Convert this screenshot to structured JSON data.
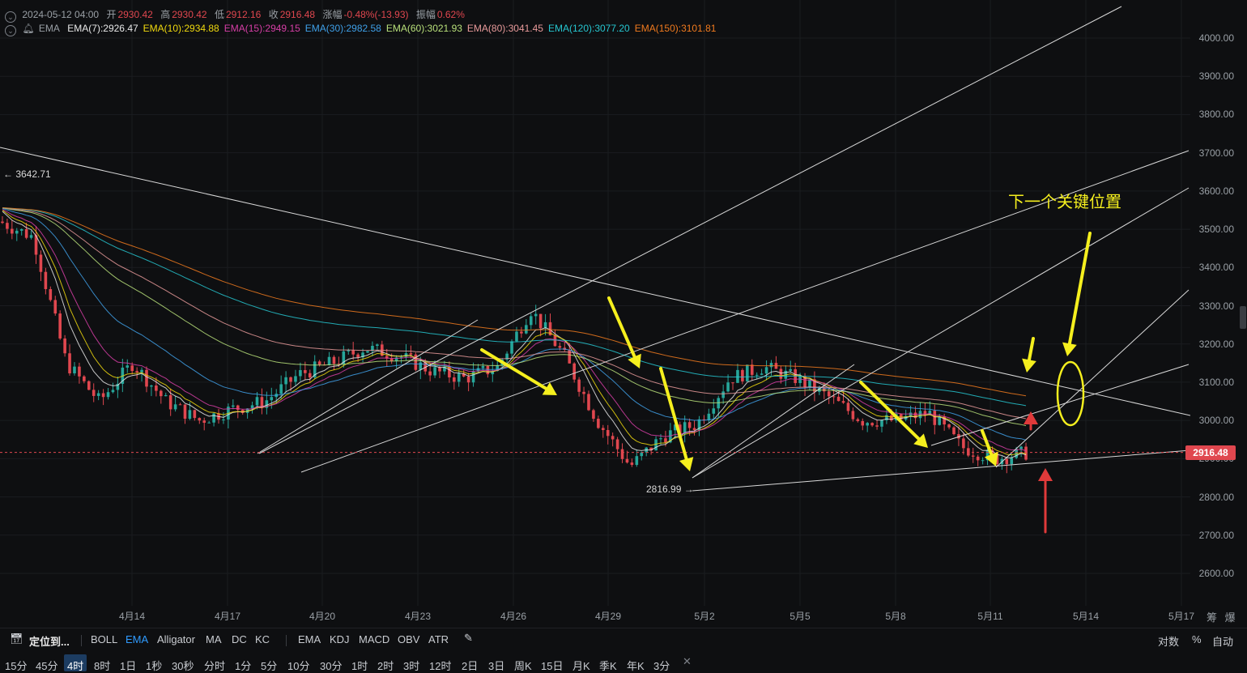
{
  "info": {
    "date": "2024-05-12 04:00",
    "open_label": "开",
    "open": "2930.42",
    "high_label": "高",
    "high": "2930.42",
    "low_label": "低",
    "low": "2912.16",
    "close_label": "收",
    "close": "2916.48",
    "change_label": "涨幅",
    "change": "-0.48%(-13.93)",
    "amp_label": "振幅",
    "amp": "0.62%",
    "ema_label": "EMA"
  },
  "emas": [
    {
      "text": "EMA(7):2926.47",
      "color": "#e8e8e8"
    },
    {
      "text": "EMA(10):2934.88",
      "color": "#f0d90e"
    },
    {
      "text": "EMA(15):2949.15",
      "color": "#d63ea6"
    },
    {
      "text": "EMA(30):2982.58",
      "color": "#3fa0e8"
    },
    {
      "text": "EMA(60):3021.93",
      "color": "#b8e07a"
    },
    {
      "text": "EMA(80):3041.45",
      "color": "#e89a9a"
    },
    {
      "text": "EMA(120):3077.20",
      "color": "#26c6d0"
    },
    {
      "text": "EMA(150):3101.81",
      "color": "#f07a1e"
    }
  ],
  "chart_data": {
    "type": "candlestick",
    "price_ticks": [
      "4000.00",
      "3900.00",
      "3800.00",
      "3700.00",
      "3600.00",
      "3500.00",
      "3400.00",
      "3300.00",
      "3200.00",
      "3100.00",
      "3000.00",
      "2900.00",
      "2800.00",
      "2700.00",
      "2600.00"
    ],
    "date_ticks": [
      "4月14",
      "4月17",
      "4月20",
      "4月23",
      "4月26",
      "4月29",
      "5月2",
      "5月5",
      "5月8",
      "5月11",
      "5月14",
      "5月17"
    ],
    "current_price": "2916.48",
    "high_marker": "3642.71",
    "low_marker": "2816.99",
    "annotation": "下一个关键位置",
    "close_path": [
      [
        "4月13",
        3520
      ],
      [
        "4月14",
        3480
      ],
      [
        "4月14",
        3150
      ],
      [
        "4月15",
        3050
      ],
      [
        "4月16",
        3150
      ],
      [
        "4月17",
        3050
      ],
      [
        "4月18",
        3000
      ],
      [
        "4月19",
        3030
      ],
      [
        "4月20",
        3050
      ],
      [
        "4月21",
        3120
      ],
      [
        "4月23",
        3150
      ],
      [
        "4月24",
        3190
      ],
      [
        "4月25",
        3170
      ],
      [
        "4月26",
        3130
      ],
      [
        "4月27",
        3110
      ],
      [
        "4月28",
        3140
      ],
      [
        "4月29",
        3290
      ],
      [
        "4月30",
        3170
      ],
      [
        "5月1",
        3000
      ],
      [
        "5月1",
        2880
      ],
      [
        "5月2",
        2960
      ],
      [
        "5月3",
        2990
      ],
      [
        "5月4",
        3110
      ],
      [
        "5月5",
        3140
      ],
      [
        "5月6",
        3110
      ],
      [
        "5月7",
        3060
      ],
      [
        "5月8",
        3000
      ],
      [
        "5月9",
        3000
      ],
      [
        "5月10",
        3020
      ],
      [
        "5月10",
        2930
      ],
      [
        "5月11",
        2900
      ],
      [
        "5月12",
        2916
      ]
    ]
  },
  "price_label": "2916.48",
  "toolbar1": {
    "locate": "定位到...",
    "indicators": [
      "BOLL",
      "EMA",
      "Alligator",
      "MA",
      "DC",
      "KC"
    ],
    "indicators2": [
      "EMA",
      "KDJ",
      "MACD",
      "OBV",
      "ATR"
    ],
    "right": [
      "对数",
      "%",
      "自动"
    ]
  },
  "toolbar2": {
    "intervals": [
      "15分",
      "45分",
      "4时",
      "8时",
      "1日",
      "1秒",
      "30秒",
      "分时",
      "1分",
      "5分",
      "10分",
      "30分",
      "1时",
      "2时",
      "3时",
      "12时",
      "2日",
      "3日",
      "周K",
      "15日",
      "月K",
      "季K",
      "年K",
      "3分"
    ],
    "active": "4时"
  },
  "axis_corner": [
    "筹",
    "爆"
  ]
}
